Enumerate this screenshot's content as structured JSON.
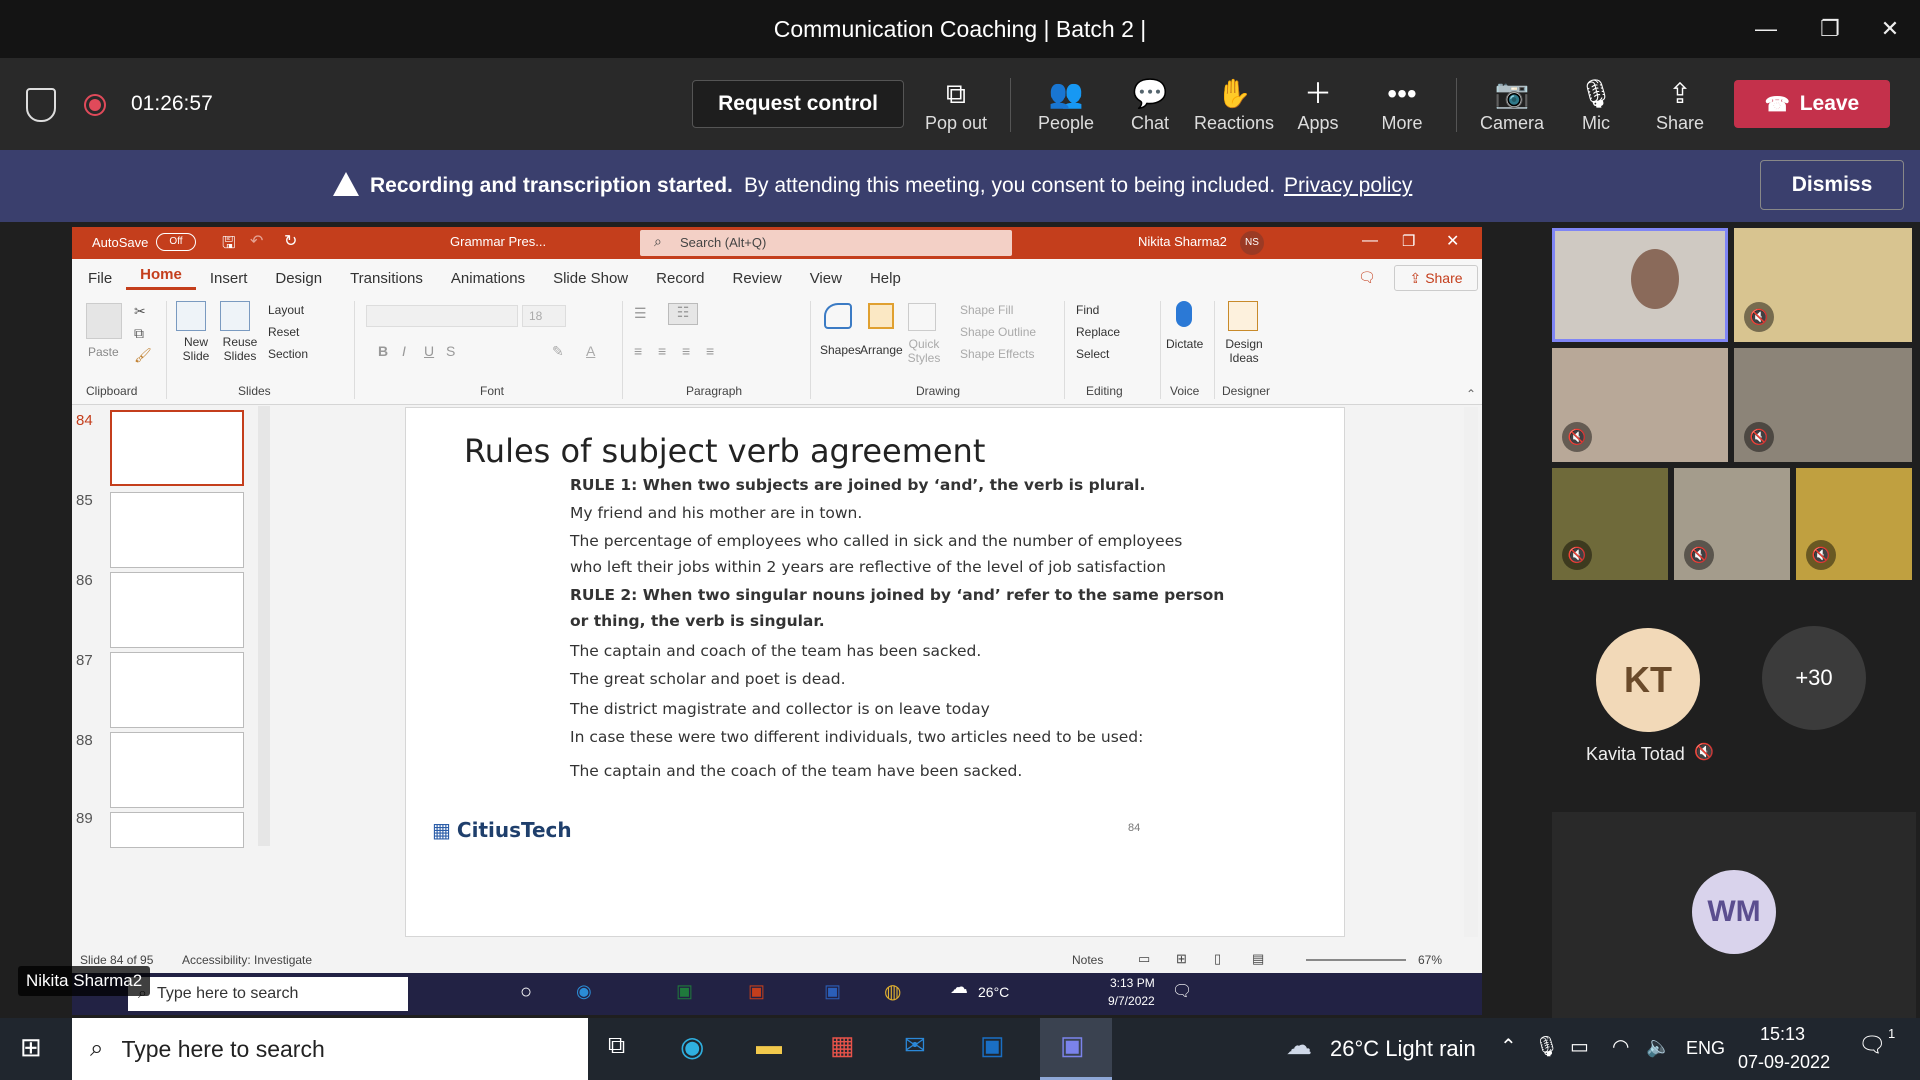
{
  "window": {
    "title": "Communication Coaching | Batch 2 |"
  },
  "toolbar": {
    "timer": "01:26:57",
    "request_control": "Request control",
    "buttons": [
      {
        "label": "Pop out",
        "icon": "popout-icon"
      },
      {
        "label": "People",
        "icon": "people-icon"
      },
      {
        "label": "Chat",
        "icon": "chat-icon"
      },
      {
        "label": "Reactions",
        "icon": "reactions-icon"
      },
      {
        "label": "Apps",
        "icon": "plus-icon"
      },
      {
        "label": "More",
        "icon": "more-icon"
      },
      {
        "label": "Camera",
        "icon": "camera-off-icon"
      },
      {
        "label": "Mic",
        "icon": "mic-off-icon"
      },
      {
        "label": "Share",
        "icon": "share-icon"
      }
    ],
    "leave": "Leave",
    "leave_color": "#c4314b"
  },
  "banner": {
    "bold": "Recording and transcription started.",
    "text": "By attending this meeting, you consent to being included.",
    "link": "Privacy policy",
    "dismiss": "Dismiss"
  },
  "ppt": {
    "autosave": "AutoSave",
    "autosave_state": "Off",
    "filename": "Grammar Pres...",
    "search": "Search (Alt+Q)",
    "user": "Nikita Sharma2",
    "user_initials": "NS",
    "tabs": [
      "File",
      "Home",
      "Insert",
      "Design",
      "Transitions",
      "Animations",
      "Slide Show",
      "Record",
      "Review",
      "View",
      "Help"
    ],
    "active_tab": "Home",
    "share": "Share",
    "ribbon": {
      "paste": "Paste",
      "new_slide": "New Slide",
      "reuse_slides": "Reuse Slides",
      "layout": "Layout",
      "reset": "Reset",
      "section": "Section",
      "font_size": "18",
      "shapes": "Shapes",
      "arrange": "Arrange",
      "quick_styles": "Quick Styles",
      "shape_fill": "Shape Fill",
      "shape_outline": "Shape Outline",
      "shape_effects": "Shape Effects",
      "find": "Find",
      "replace": "Replace",
      "select": "Select",
      "dictate": "Dictate",
      "design_ideas": "Design Ideas",
      "groups": [
        "Clipboard",
        "Slides",
        "Font",
        "Paragraph",
        "Drawing",
        "Editing",
        "Voice",
        "Designer"
      ]
    },
    "thumb_numbers": [
      "84",
      "85",
      "86",
      "87",
      "88",
      "89"
    ],
    "slide": {
      "title": "Rules of subject verb agreement",
      "lines": [
        {
          "text": "RULE 1: When two subjects are joined by ‘and’, the verb is plural.",
          "bold": true
        },
        {
          "text": "My friend and his mother are in town.",
          "bold": false
        },
        {
          "text": "The percentage of employees who called in sick and the number of employees",
          "bold": false
        },
        {
          "text": "who left their jobs within 2 years are reflective of the level of job satisfaction",
          "bold": false
        },
        {
          "text": "RULE 2: When two singular nouns joined by ‘and’ refer to the same person",
          "bold": true
        },
        {
          "text": "or thing, the verb is singular.",
          "bold": true
        },
        {
          "text": "The captain and coach of the team has been sacked.",
          "bold": false
        },
        {
          "text": "The great scholar and poet is dead.",
          "bold": false
        },
        {
          "text": "The district magistrate and collector is on leave today",
          "bold": false
        },
        {
          "text": "In case these were two different individuals, two articles need to be used:",
          "bold": false
        },
        {
          "text": "The captain and the coach of the team have been sacked.",
          "bold": false
        }
      ],
      "logo": "CitiusTech",
      "number": "84"
    },
    "status": {
      "slide_of": "Slide 84 of 95",
      "accessibility": "Accessibility: Investigate",
      "notes": "Notes",
      "zoom": "67%"
    }
  },
  "inner_taskbar": {
    "search": "Type here to search",
    "temp": "26°C",
    "time": "3:13 PM",
    "date": "9/7/2022"
  },
  "presenter_label": "Nikita Sharma2",
  "participants": {
    "kt_initials": "KT",
    "kt_name": "Kavita Totad",
    "kt_color": "#f2d9b8",
    "overflow": "+30",
    "wm_initials": "WM",
    "wm_color": "#d9d3ec"
  },
  "taskbar": {
    "search": "Type here to search",
    "weather": "26°C  Light rain",
    "lang": "ENG",
    "time": "15:13",
    "date": "07-09-2022",
    "notification_count": "1"
  }
}
